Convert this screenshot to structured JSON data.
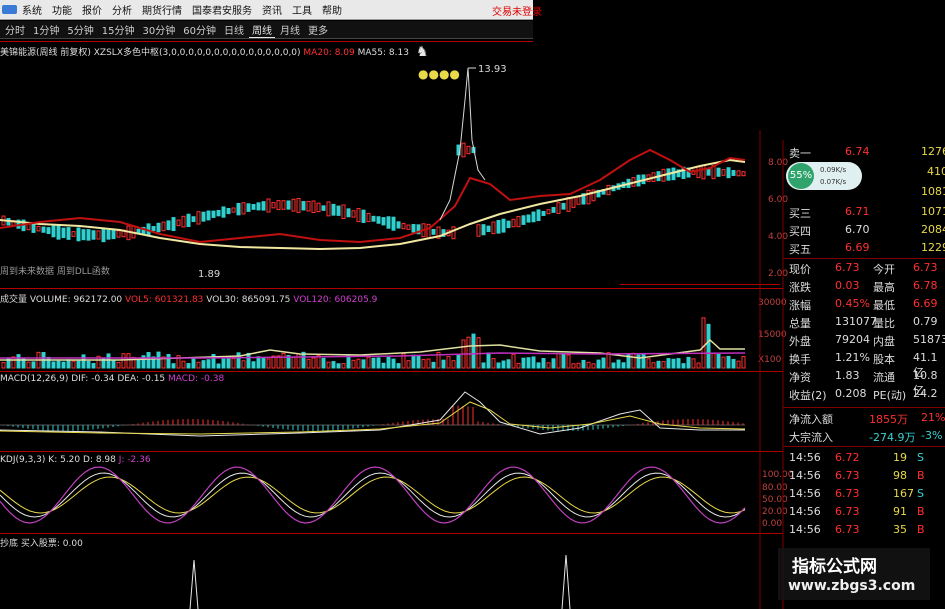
{
  "menu": {
    "items": [
      "系统",
      "功能",
      "报价",
      "分析",
      "期货行情",
      "国泰君安服务",
      "资讯",
      "工具",
      "帮助"
    ],
    "trade_label": "交易未登录"
  },
  "periods": {
    "items": [
      "分时",
      "1分钟",
      "5分钟",
      "15分钟",
      "30分钟",
      "60分钟",
      "日线",
      "周线",
      "月线",
      "更多"
    ],
    "active": "周线"
  },
  "main_indicator": {
    "stock": "美锦能源(周线 前复权)",
    "ind": "XZSLX多色中枢(3,0,0,0,0,0,0,0,0,0,0,0,0,0,0,0)",
    "ma20": "MA20: 8.09",
    "ma55": "MA55: 8.13",
    "high_label": "13.93",
    "low_label": "1.89",
    "note": "周到未来数据 周到DLL函数"
  },
  "price_axis": [
    "8.00",
    "6.00",
    "4.00",
    "2.00"
  ],
  "volume": {
    "name": "成交量",
    "volume": "VOLUME: 962172.00",
    "vol5": "VOL5: 601321.83",
    "vol30": "VOL30: 865091.75",
    "vol120": "VOL120: 606205.9",
    "axis": [
      "30000",
      "15000",
      "X100"
    ]
  },
  "macd": {
    "name": "MACD(12,26,9)",
    "dif": "DIF: -0.34",
    "dea": "DEA: -0.15",
    "macd": "MACD: -0.38"
  },
  "kdj": {
    "name": "KDJ(9,3,3)",
    "k": "K: 5.20",
    "d": "D: 8.98",
    "j": "J: -2.36",
    "axis": [
      "100.00",
      "80.00",
      "50.00",
      "20.00",
      "0.00"
    ]
  },
  "bottom_ind": {
    "name": "抄底 买入股票: 0.00"
  },
  "quote": {
    "top_ask": {
      "label": "卖一",
      "price": "6.74",
      "vol": "1276"
    },
    "top_rows": [
      {
        "vol": "410"
      },
      {
        "vol": "1081"
      }
    ],
    "bids": [
      {
        "label": "买三",
        "price": "6.71",
        "vol": "1071"
      },
      {
        "label": "买四",
        "price": "6.70",
        "vol": "2084"
      },
      {
        "label": "买五",
        "price": "6.69",
        "vol": "1229"
      }
    ],
    "stats": [
      {
        "l1": "现价",
        "v1": "6.73",
        "l2": "今开",
        "v2": "6.73"
      },
      {
        "l1": "涨跌",
        "v1": "0.03",
        "l2": "最高",
        "v2": "6.78"
      },
      {
        "l1": "涨幅",
        "v1": "0.45%",
        "l2": "最低",
        "v2": "6.69"
      },
      {
        "l1": "总量",
        "v1": "131077",
        "l2": "量比",
        "v2": "0.79"
      },
      {
        "l1": "外盘",
        "v1": "79204",
        "l2": "内盘",
        "v2": "51873"
      },
      {
        "l1": "换手",
        "v1": "1.21%",
        "l2": "股本",
        "v2": "41.1亿"
      },
      {
        "l1": "净资",
        "v1": "1.83",
        "l2": "流通",
        "v2": "10.8亿"
      },
      {
        "l1": "收益(2)",
        "v1": "0.208",
        "l2": "PE(动)",
        "v2": "24.2"
      }
    ],
    "flows": [
      {
        "label": "净流入额",
        "v1": "1855万",
        "v2": "21%"
      },
      {
        "label": "大宗流入",
        "v1": "-274.9万",
        "v2": "-3%"
      }
    ],
    "ticks": [
      {
        "time": "14:56",
        "price": "6.72",
        "vol": "19",
        "bs": "S"
      },
      {
        "time": "14:56",
        "price": "6.73",
        "vol": "98",
        "bs": "B"
      },
      {
        "time": "14:56",
        "price": "6.73",
        "vol": "167",
        "bs": "S"
      },
      {
        "time": "14:56",
        "price": "6.73",
        "vol": "91",
        "bs": "B"
      },
      {
        "time": "14:56",
        "price": "6.73",
        "vol": "35",
        "bs": "B"
      }
    ]
  },
  "widget": {
    "pct": "55%",
    "s1": "0.09K/s",
    "s2": "0.07K/s"
  },
  "watermark": {
    "t1": "指标公式网",
    "t2": "www.zbgs3.com"
  },
  "colors": {
    "up": "#ff3030",
    "down": "#30d0d0",
    "ma_yellow": "#f0e8a0",
    "ma_red": "#c01010",
    "vol_mag": "#c030c0"
  }
}
